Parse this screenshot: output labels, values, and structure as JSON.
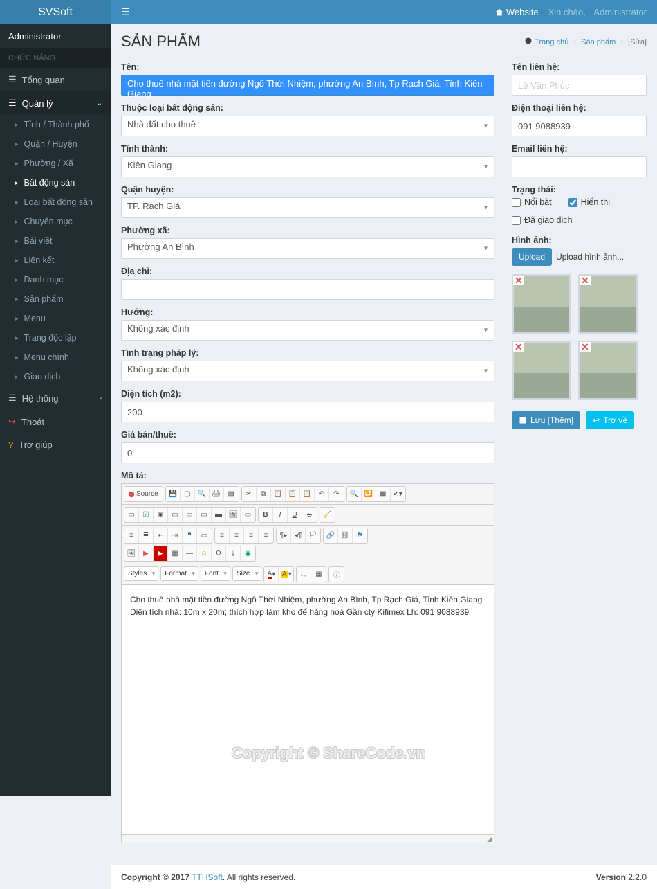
{
  "brand": "SVSoft",
  "top": {
    "website": "Website",
    "greeting_prefix": "Xin chào,",
    "greeting_user": "Administrator"
  },
  "user_panel": {
    "name": "Administrator"
  },
  "sidebar": {
    "section": "CHỨC NĂNG",
    "overview": "Tổng quan",
    "manage": "Quản lý",
    "items": [
      "Tỉnh / Thành phố",
      "Quận / Huyện",
      "Phường / Xã",
      "Bất động sản",
      "Loại bất động sản",
      "Chuyên mục",
      "Bài viết",
      "Liên kết",
      "Danh mục",
      "Sản phẩm",
      "Menu",
      "Trang độc lập",
      "Menu chính",
      "Giao dịch"
    ],
    "active_index": 3,
    "system": "Hệ thống",
    "exit": "Thoát",
    "help": "Trợ giúp"
  },
  "page": {
    "title": "SẢN PHẨM",
    "breadcrumb": {
      "home": "Trang chủ",
      "mid": "Sản phẩm",
      "tail": "[Sửa]"
    }
  },
  "form": {
    "labels": {
      "ten": "Tên:",
      "loai": "Thuộc loại bất động sản:",
      "tinh": "Tỉnh thành:",
      "quan": "Quận huyện:",
      "phuong": "Phường xã:",
      "diachi": "Địa chỉ:",
      "huong": "Hướng:",
      "phaply": "Tình trạng pháp lý:",
      "dientich": "Diện tích (m2):",
      "gia": "Giá bán/thuê:",
      "mota": "Mô tả:",
      "tenlh": "Tên liên hệ:",
      "dtlh": "Điện thoại liên hệ:",
      "emaillh": "Email liên hệ:",
      "trangthai": "Trạng thái:",
      "hinhanh": "Hình ảnh:"
    },
    "values": {
      "ten": "Cho thuê nhà mặt tiền đường Ngô Thời Nhiệm, phường An Bình, Tp Rạch Giá, Tỉnh Kiên Giang",
      "loai": "Nhà đất cho thuê",
      "tinh": "Kiên Giang",
      "quan": "TP. Rạch Giá",
      "phuong": "Phường An Bình",
      "diachi": "",
      "huong": "Không xác định",
      "phaply": "Không xác định",
      "dientich": "200",
      "gia": "0",
      "tenlh": "Lê Văn Phúc",
      "dtlh": "091 9088939",
      "emaillh": ""
    },
    "status": {
      "noibat_label": "Nổi bật",
      "noibat": false,
      "hienthi_label": "Hiển thị",
      "hienthi": true,
      "dagiaodich_label": "Đã giao dịch",
      "dagiaodich": false
    },
    "upload": {
      "btn": "Upload",
      "hint": "Upload hình ảnh..."
    },
    "actions": {
      "save": "Lưu [Thêm]",
      "back": "Trở về"
    }
  },
  "editor": {
    "source_label": "Source",
    "dropdowns": {
      "styles": "Styles",
      "format": "Format",
      "font": "Font",
      "size": "Size"
    },
    "content": "Cho thuê nhà mặt tiền đường Ngô Thời Nhiệm, phường An Bình, Tp Rạch Giá, Tỉnh Kiên Giang Diện tích nhà: 10m x 20m; thích hợp làm kho để hàng hoá Gần cty Kifimex Lh: 091 9088939"
  },
  "footer": {
    "copyright_prefix": "Copyright © 2017 ",
    "link": "TTHSoft",
    "suffix": ". All rights reserved.",
    "version_label": "Version",
    "version": " 2.2.0"
  },
  "watermarks": {
    "sharecode_top": "SHARECODE.vn",
    "sharecode_mid": "ShareCode.vn",
    "copyright": "Copyright © ShareCode.vn"
  }
}
